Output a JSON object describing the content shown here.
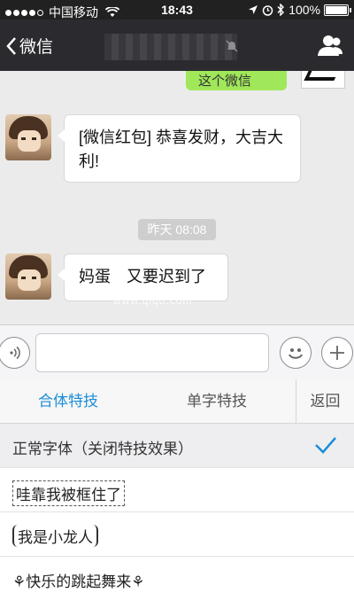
{
  "status_bar": {
    "carrier": "中国移动",
    "time": "18:43",
    "battery": "100%",
    "battery_level": 1.0
  },
  "nav": {
    "back_label": "微信"
  },
  "chat": {
    "previous_message_fragment": "这个微信",
    "messages": [
      {
        "sender": "other",
        "text": "[微信红包] 恭喜发财，大吉大利!"
      },
      {
        "sender": "other",
        "text": "妈蛋　又要迟到了"
      }
    ],
    "timestamp": "昨天 08:08",
    "watermark": "www.qiqu.com"
  },
  "effects_panel": {
    "tabs": [
      {
        "label": "合体特技",
        "active": true
      },
      {
        "label": "单字特技",
        "active": false
      },
      {
        "label": "返回",
        "active": false
      }
    ],
    "items": [
      {
        "label": "正常字体（关闭特技效果）",
        "selected": true
      },
      {
        "label": "哇靠我被框住了",
        "selected": false
      },
      {
        "label": "我是小龙人",
        "selected": false
      },
      {
        "label": "快乐的跳起舞来",
        "selected": false
      }
    ]
  },
  "colors": {
    "accent": "#1a8ed9",
    "nav_bg": "#2b2b2f",
    "bubble_green": "#a0e75a"
  },
  "icons": [
    "signal-icon",
    "wifi-icon",
    "location-icon",
    "alarm-icon",
    "bluetooth-icon",
    "battery-icon",
    "chevron-left-icon",
    "mute-icon",
    "contact-info-icon",
    "voice-icon",
    "emoji-icon",
    "plus-icon",
    "checkmark-icon"
  ]
}
